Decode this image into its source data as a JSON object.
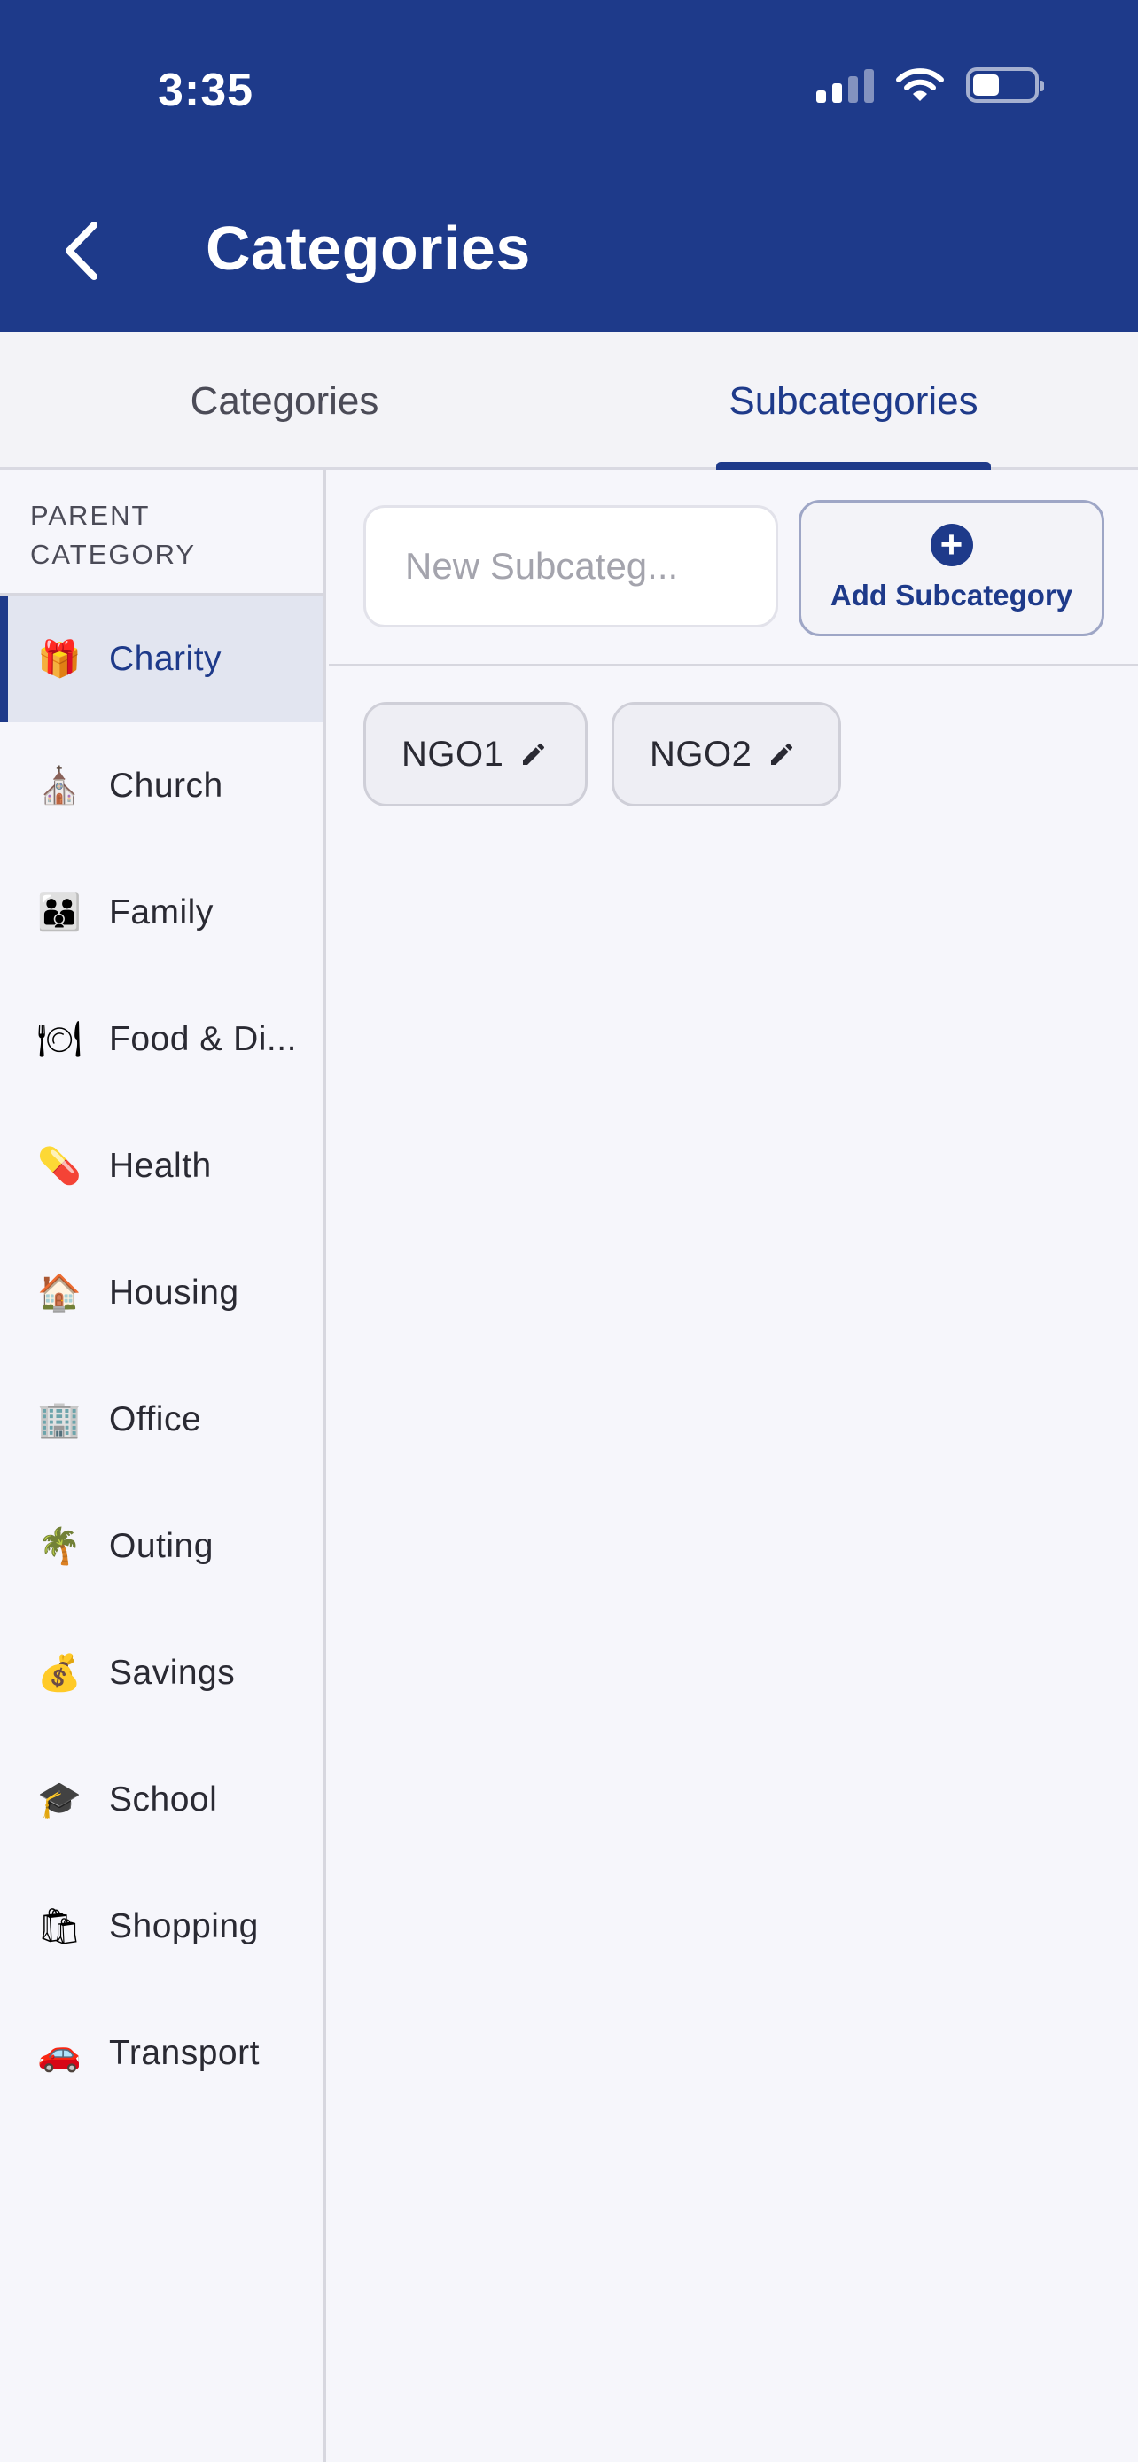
{
  "status_bar": {
    "time": "3:35"
  },
  "header": {
    "title": "Categories"
  },
  "tabs": [
    {
      "label": "Categories",
      "active": false
    },
    {
      "label": "Subcategories",
      "active": true
    }
  ],
  "sidebar": {
    "header": "PARENT CATEGORY",
    "items": [
      {
        "label": "Charity",
        "emoji": "🎁",
        "icon": "gift-icon",
        "active": true
      },
      {
        "label": "Church",
        "emoji": "⛪",
        "icon": "church-icon",
        "active": false
      },
      {
        "label": "Family",
        "emoji": "👪",
        "icon": "family-icon",
        "active": false
      },
      {
        "label": "Food & Di...",
        "emoji": "🍽",
        "icon": "plate-icon",
        "active": false
      },
      {
        "label": "Health",
        "emoji": "💊",
        "icon": "pill-icon",
        "active": false
      },
      {
        "label": "Housing",
        "emoji": "🏠",
        "icon": "house-icon",
        "active": false
      },
      {
        "label": "Office",
        "emoji": "🏢",
        "icon": "office-icon",
        "active": false
      },
      {
        "label": "Outing",
        "emoji": "🌴",
        "icon": "palm-tree-icon",
        "active": false
      },
      {
        "label": "Savings",
        "emoji": "💰",
        "icon": "money-bag-icon",
        "active": false
      },
      {
        "label": "School",
        "emoji": "🎓",
        "icon": "graduation-cap-icon",
        "active": false
      },
      {
        "label": "Shopping",
        "emoji": "🛍",
        "icon": "shopping-bags-icon",
        "active": false
      },
      {
        "label": "Transport",
        "emoji": "🚗",
        "icon": "car-icon",
        "active": false
      }
    ]
  },
  "main": {
    "input_placeholder": "New Subcateg...",
    "add_button_label": "Add Subcategory",
    "subcategories": [
      {
        "label": "NGO1"
      },
      {
        "label": "NGO2"
      }
    ]
  },
  "colors": {
    "primary": "#1e3a8a",
    "background": "#f6f6fb",
    "active_item_bg": "#e2e5f0"
  }
}
